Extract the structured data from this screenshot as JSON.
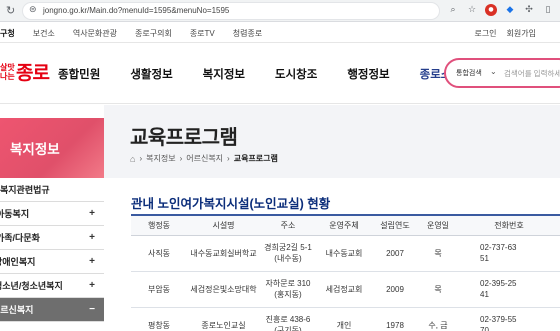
{
  "browser": {
    "url": "jongno.go.kr/Main.do?menuId=1595&menuNo=1595"
  },
  "topbar": {
    "links": [
      "구청",
      "보건소",
      "역사문화관광",
      "종로구의회",
      "종로TV",
      "청렴종로"
    ],
    "login": "로그인",
    "signup": "회원가입"
  },
  "logo": {
    "small": "살맛나는",
    "big": "종로"
  },
  "gnb": {
    "items": [
      "종합민원",
      "생활정보",
      "복지정보",
      "도시창조",
      "행정정보",
      "종로소개"
    ],
    "accent_index": 5
  },
  "search": {
    "category": "통합검색",
    "placeholder": "검색어를 입력하세요"
  },
  "banner": {
    "section": "복지정보",
    "page_title": "교육프로그램",
    "breadcrumb": [
      "복지정보",
      "어르신복지",
      "교육프로그램"
    ]
  },
  "sidebar": {
    "items": [
      {
        "label": "복지관련법규",
        "toggle": ""
      },
      {
        "label": "아동복지",
        "toggle": "+"
      },
      {
        "label": "가족/다문화",
        "toggle": "+"
      },
      {
        "label": "장애인복지",
        "toggle": "+"
      },
      {
        "label": "청소년/청소년복지",
        "toggle": "+"
      },
      {
        "label": "어르신복지",
        "toggle": "−"
      }
    ]
  },
  "content": {
    "section_title": "관내 노인여가복지시설(노인교실) 현황",
    "columns": [
      "행정동",
      "시설명",
      "주소",
      "운영주체",
      "설립연도",
      "운영일",
      "전화번호"
    ],
    "rows": [
      [
        "사직동",
        "내수동교회실버학교",
        "경희궁2길 5-1\n(내수동)",
        "내수동교회",
        "2007",
        "목",
        "02-737-63\n51"
      ],
      [
        "부암동",
        "세검정은빛소망대학",
        "자하문로 310\n(홍지동)",
        "세검정교회",
        "2009",
        "목",
        "02-395-25\n41"
      ],
      [
        "평창동",
        "종로노인교실",
        "진흥로 438-6\n(구기동)",
        "개인",
        "1978",
        "수, 금",
        "02-379-55\n70"
      ]
    ]
  },
  "colors": {
    "brand_red": "#e50012",
    "banner_pink": "#ee5570",
    "navy": "#0b2d7a",
    "search_border": "#e0507c"
  }
}
